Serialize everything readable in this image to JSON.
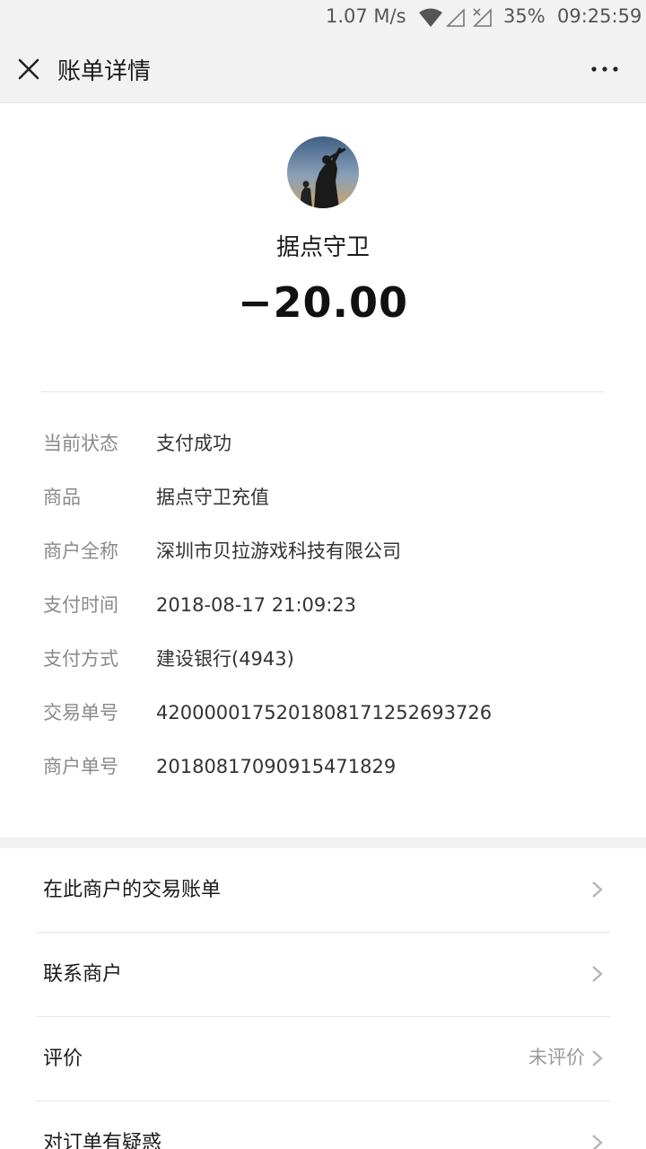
{
  "status_bar": {
    "speed": "1.07 M/s",
    "battery": "35%",
    "time": "09:25:59"
  },
  "title_bar": {
    "title": "账单详情",
    "close_icon": "close-icon",
    "more_icon": "more-icon"
  },
  "summary": {
    "merchant_name": "据点守卫",
    "amount": "−20.00"
  },
  "details": [
    {
      "label": "当前状态",
      "value": "支付成功"
    },
    {
      "label": "商品",
      "value": "据点守卫充值"
    },
    {
      "label": "商户全称",
      "value": "深圳市贝拉游戏科技有限公司"
    },
    {
      "label": "支付时间",
      "value": "2018-08-17 21:09:23"
    },
    {
      "label": "支付方式",
      "value": "建设银行(4943)"
    },
    {
      "label": "交易单号",
      "value": "4200000175201808171252693726"
    },
    {
      "label": "商户单号",
      "value": "20180817090915471829"
    }
  ],
  "menu": [
    {
      "label": "在此商户的交易账单",
      "extra": ""
    },
    {
      "label": "联系商户",
      "extra": ""
    },
    {
      "label": "评价",
      "extra": "未评价"
    },
    {
      "label": "对订单有疑惑",
      "extra": ""
    }
  ],
  "colors": {
    "background": "#ffffff",
    "bar": "#f2f2f2",
    "label_gray": "#8a8a8a",
    "text": "#1a1a1a"
  }
}
